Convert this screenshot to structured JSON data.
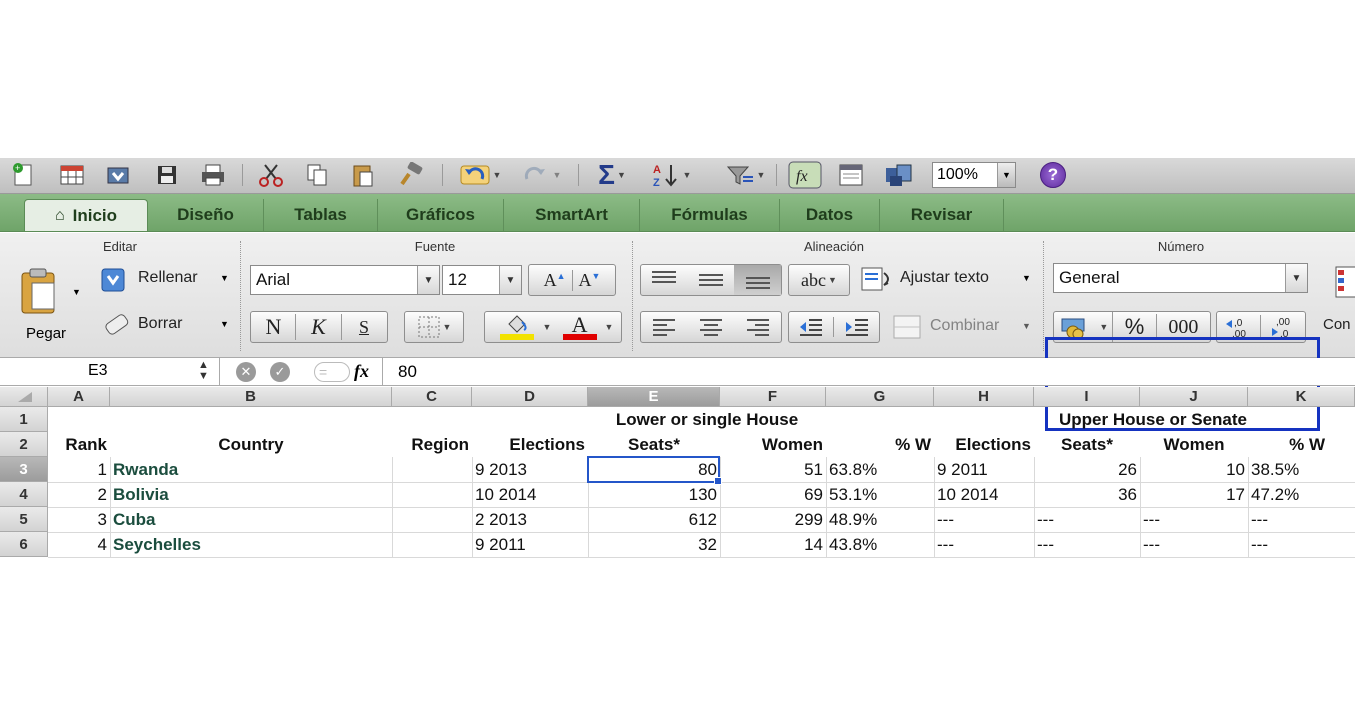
{
  "toolbar": {
    "zoom": "100%",
    "help": "?"
  },
  "tabs": [
    "Inicio",
    "Diseño",
    "Tablas",
    "Gráficos",
    "SmartArt",
    "Fórmulas",
    "Datos",
    "Revisar"
  ],
  "ribbon": {
    "groups": {
      "editar": "Editar",
      "fuente": "Fuente",
      "alineacion": "Alineación",
      "numero": "Número"
    },
    "pegar": "Pegar",
    "rellenar": "Rellenar",
    "borrar": "Borrar",
    "font_name": "Arial",
    "font_size": "12",
    "bold": "N",
    "italic": "K",
    "underline": "S",
    "abc": "abc",
    "ajustar": "Ajustar texto",
    "combinar": "Combinar",
    "number_format": "General",
    "percent": "%",
    "thousands": "000",
    "dec_inc": "←,0 ,00",
    "dec_dec": ",00 →,0",
    "cond_format_partial": "Con Fo",
    "colors": {
      "highlight": "#f2e200",
      "font_color": "#e00000",
      "selection_box": "#1533c0"
    }
  },
  "formula_bar": {
    "cell_ref": "E3",
    "fx": "fx",
    "value": "80"
  },
  "sheet": {
    "columns": [
      "A",
      "B",
      "C",
      "D",
      "E",
      "F",
      "G",
      "H",
      "I",
      "J",
      "K"
    ],
    "selected_column": "E",
    "selected_row": "3",
    "rows": [
      "1",
      "2",
      "3",
      "4",
      "5",
      "6"
    ],
    "row1": {
      "lower": "Lower or single House",
      "upper": "Upper House or Senate"
    },
    "headers": [
      "Rank",
      "Country",
      "Region",
      "Elections",
      "Seats*",
      "Women",
      "% W",
      "Elections",
      "Seats*",
      "Women",
      "% W"
    ],
    "data": [
      [
        "1",
        "Rwanda",
        "",
        "9 2013",
        "80",
        "51",
        "63.8%",
        "9 2011",
        "26",
        "10",
        "38.5%"
      ],
      [
        "2",
        "Bolivia",
        "",
        "10 2014",
        "130",
        "69",
        "53.1%",
        "10 2014",
        "36",
        "17",
        "47.2%"
      ],
      [
        "3",
        "Cuba",
        "",
        "2 2013",
        "612",
        "299",
        "48.9%",
        "---",
        "---",
        "---",
        "---"
      ],
      [
        "4",
        "Seychelles",
        "",
        "9 2011",
        "32",
        "14",
        "43.8%",
        "---",
        "---",
        "---",
        "---"
      ]
    ]
  }
}
